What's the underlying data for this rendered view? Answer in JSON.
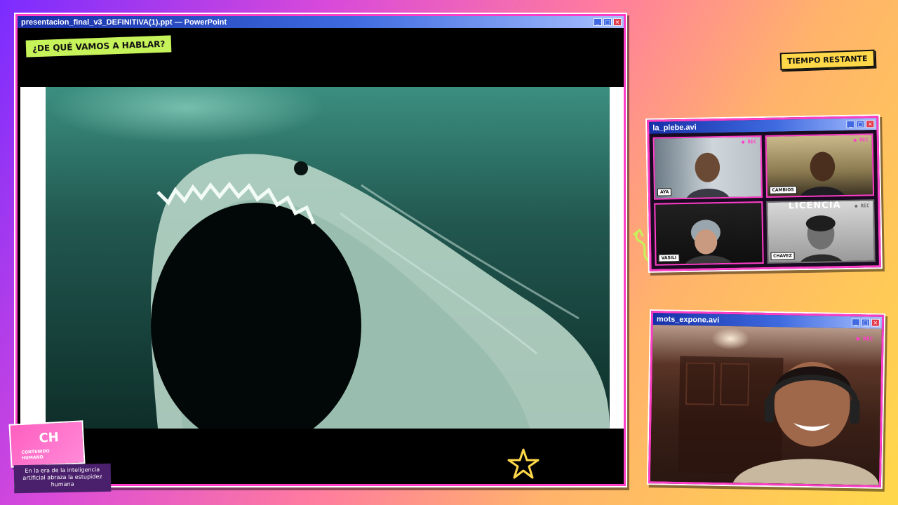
{
  "main_window": {
    "title": "presentacion_final_v3_DEFINITIVA(1).ppt — PowerPoint",
    "section_sticker": "¿DE QUÉ VAMOS A HABLAR?"
  },
  "timer_badge": "TIEMPO RESTANTE",
  "grid_window": {
    "title": "la_plebe.avi",
    "overlay_text": "LICENCIA",
    "participants": [
      {
        "name": "AYA",
        "rec": "● REC"
      },
      {
        "name": "CAMBIOS",
        "rec": "● REC"
      },
      {
        "name": "VASILI",
        "rec": ""
      },
      {
        "name": "CHAVEZ",
        "rec": "● REC"
      }
    ]
  },
  "presenter_window": {
    "title": "mots_expone.avi",
    "rec": "● REC"
  },
  "logo": {
    "mark": "CH",
    "name": "CONTENIDO HUMANO",
    "tagline": "En la era de la inteligencia artificial abraza la estupidez humana"
  },
  "window_buttons": {
    "minimize": "_",
    "maximize": "□",
    "close": "×"
  },
  "colors": {
    "frame_pink": "#ff3ec8",
    "title_blue": "#1730a8",
    "sticker_green": "#c6f25a",
    "badge_yellow": "#ffd84a"
  }
}
